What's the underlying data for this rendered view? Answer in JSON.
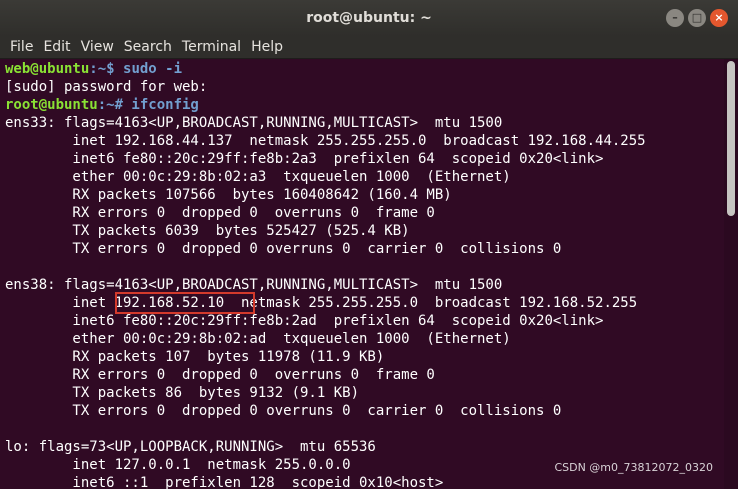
{
  "window": {
    "title": "root@ubuntu: ~"
  },
  "menu": [
    "File",
    "Edit",
    "View",
    "Search",
    "Terminal",
    "Help"
  ],
  "lines": {
    "l0": {
      "user": "web@ubuntu",
      "rest": ":~$ sudo -i"
    },
    "l1": "[sudo] password for web:",
    "l2": {
      "user": "root@ubuntu",
      "rest": ":~# ifconfig"
    },
    "l3": "ens33: flags=4163<UP,BROADCAST,RUNNING,MULTICAST>  mtu 1500",
    "l4": "        inet 192.168.44.137  netmask 255.255.255.0  broadcast 192.168.44.255",
    "l5": "        inet6 fe80::20c:29ff:fe8b:2a3  prefixlen 64  scopeid 0x20<link>",
    "l6": "        ether 00:0c:29:8b:02:a3  txqueuelen 1000  (Ethernet)",
    "l7": "        RX packets 107566  bytes 160408642 (160.4 MB)",
    "l8": "        RX errors 0  dropped 0  overruns 0  frame 0",
    "l9": "        TX packets 6039  bytes 525427 (525.4 KB)",
    "l10": "        TX errors 0  dropped 0 overruns 0  carrier 0  collisions 0",
    "l11": "",
    "l12": "ens38: flags=4163<UP,BROADCAST,RUNNING,MULTICAST>  mtu 1500",
    "l13": "        inet 192.168.52.10  netmask 255.255.255.0  broadcast 192.168.52.255",
    "l14": "        inet6 fe80::20c:29ff:fe8b:2ad  prefixlen 64  scopeid 0x20<link>",
    "l15": "        ether 00:0c:29:8b:02:ad  txqueuelen 1000  (Ethernet)",
    "l16": "        RX packets 107  bytes 11978 (11.9 KB)",
    "l17": "        RX errors 0  dropped 0  overruns 0  frame 0",
    "l18": "        TX packets 86  bytes 9132 (9.1 KB)",
    "l19": "        TX errors 0  dropped 0 overruns 0  carrier 0  collisions 0",
    "l20": "",
    "l21": "lo: flags=73<UP,LOOPBACK,RUNNING>  mtu 65536",
    "l22": "        inet 127.0.0.1  netmask 255.0.0.0",
    "l23": "        inet6 ::1  prefixlen 128  scopeid 0x10<host>"
  },
  "watermark": "CSDN @m0_73812072_0320",
  "colors": {
    "background": "#300a24",
    "user_prompt": "#8ae234",
    "path_prompt": "#729fcf",
    "highlight_box": "#d33a2c"
  }
}
